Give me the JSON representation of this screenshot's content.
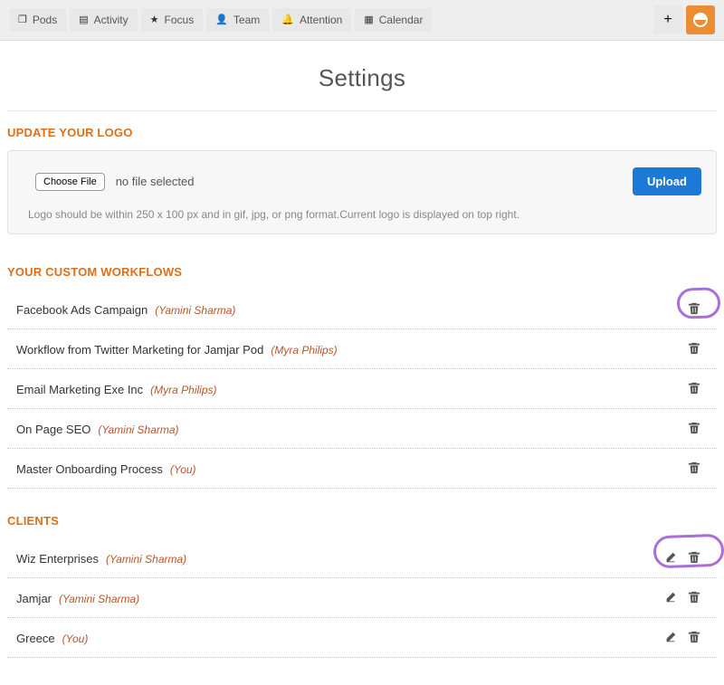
{
  "nav": {
    "tabs": [
      {
        "label": "Pods",
        "icon": "❐"
      },
      {
        "label": "Activity",
        "icon": "▤"
      },
      {
        "label": "Focus",
        "icon": "★"
      },
      {
        "label": "Team",
        "icon": "👤"
      },
      {
        "label": "Attention",
        "icon": "🔔"
      },
      {
        "label": "Calendar",
        "icon": "▦"
      }
    ]
  },
  "page": {
    "title": "Settings"
  },
  "logo_section": {
    "heading": "UPDATE YOUR LOGO",
    "choose_button": "Choose File",
    "file_status": "no file selected",
    "upload_button": "Upload",
    "hint": "Logo should be within 250 x 100 px and in gif, jpg, or png format.Current logo is displayed on top right."
  },
  "workflows": {
    "heading": "YOUR CUSTOM WORKFLOWS",
    "items": [
      {
        "title": "Facebook Ads Campaign",
        "owner": "(Yamini Sharma)",
        "highlighted": true
      },
      {
        "title": "Workflow from Twitter Marketing for Jamjar Pod",
        "owner": "(Myra Philips)"
      },
      {
        "title": "Email Marketing Exe Inc",
        "owner": "(Myra Philips)"
      },
      {
        "title": "On Page SEO",
        "owner": "(Yamini Sharma)"
      },
      {
        "title": "Master Onboarding Process",
        "owner": "(You)"
      }
    ]
  },
  "clients": {
    "heading": "CLIENTS",
    "items": [
      {
        "title": "Wiz Enterprises",
        "owner": "(Yamini Sharma)",
        "highlighted": true
      },
      {
        "title": "Jamjar",
        "owner": "(Yamini Sharma)"
      },
      {
        "title": "Greece",
        "owner": "(You)"
      }
    ]
  }
}
